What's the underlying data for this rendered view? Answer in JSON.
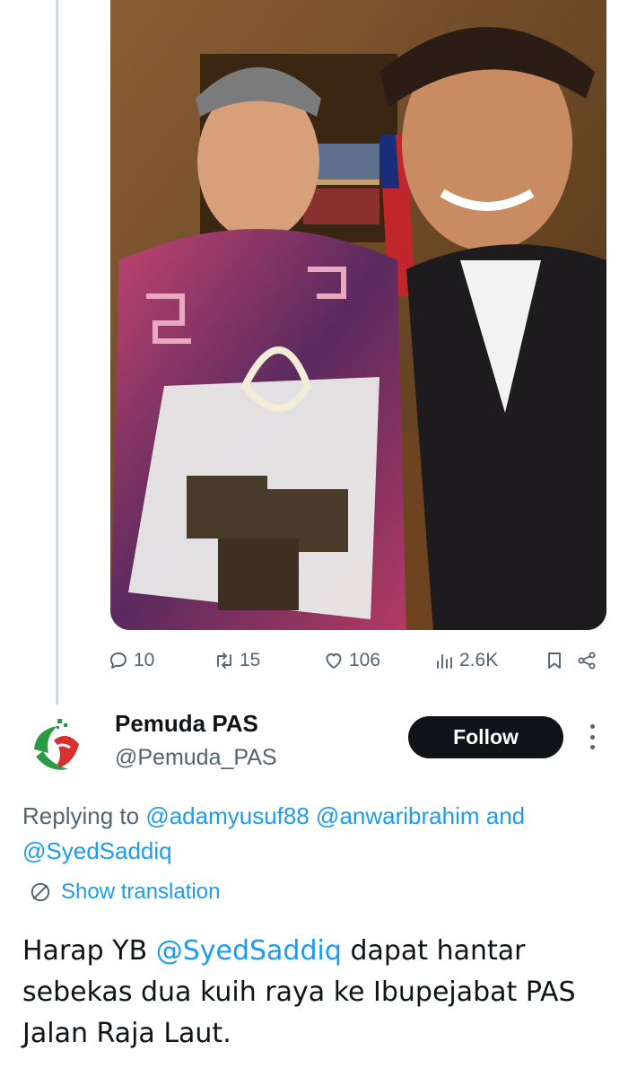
{
  "tweet": {
    "photo_alt": "",
    "actions": {
      "replies": "10",
      "retweets": "15",
      "likes": "106",
      "views": "2.6K"
    }
  },
  "reply": {
    "display_name": "Pemuda PAS",
    "handle": "@Pemuda_PAS",
    "follow_label": "Follow",
    "replying_prefix": "Replying to",
    "replying_to": [
      "@adamyusuf88",
      "@anwaribrahim",
      "@SyedSaddiq"
    ],
    "replying_joiner": "and",
    "translation_label": "Show translation",
    "text_before": "Harap YB",
    "text_mention": "@SyedSaddiq",
    "text_after": "dapat hantar sebekas dua kuih raya ke Ibupejabat PAS Jalan Raja Laut."
  },
  "colors": {
    "accent": "#1d9bf0",
    "text": "#0f1419",
    "secondary": "#536471",
    "follow_bg": "#0f1419"
  },
  "icons": [
    "reply-icon",
    "retweet-icon",
    "like-icon",
    "views-icon",
    "bookmark-icon",
    "share-icon",
    "more-icon",
    "translate-icon"
  ]
}
